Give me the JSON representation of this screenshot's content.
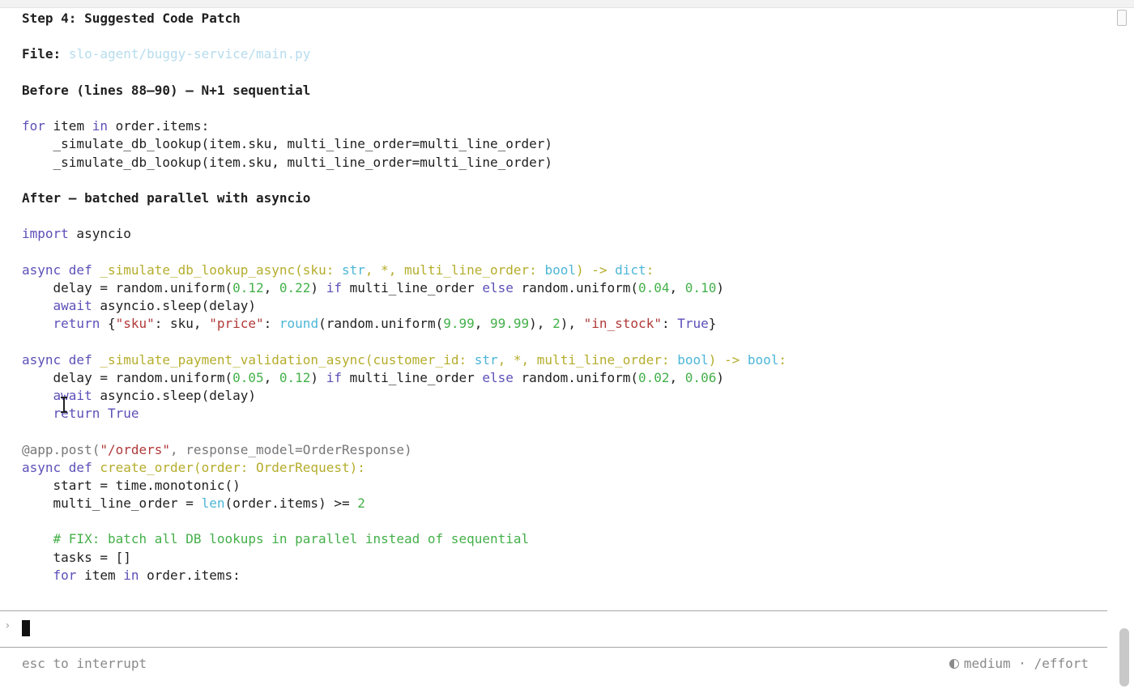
{
  "output": {
    "step_title": "Step 4: Suggested Code Patch",
    "file_label": "File:",
    "file_path": "slo-agent/buggy-service/main.py",
    "before_heading": "Before (lines 88–90) — N+1 sequential",
    "after_heading": "After — batched parallel with asyncio"
  },
  "prompt": {
    "chevron": "›",
    "value": ""
  },
  "status": {
    "hint": "esc to interrupt",
    "effort_level": "medium",
    "separator": "·",
    "effort_command": "/effort"
  }
}
